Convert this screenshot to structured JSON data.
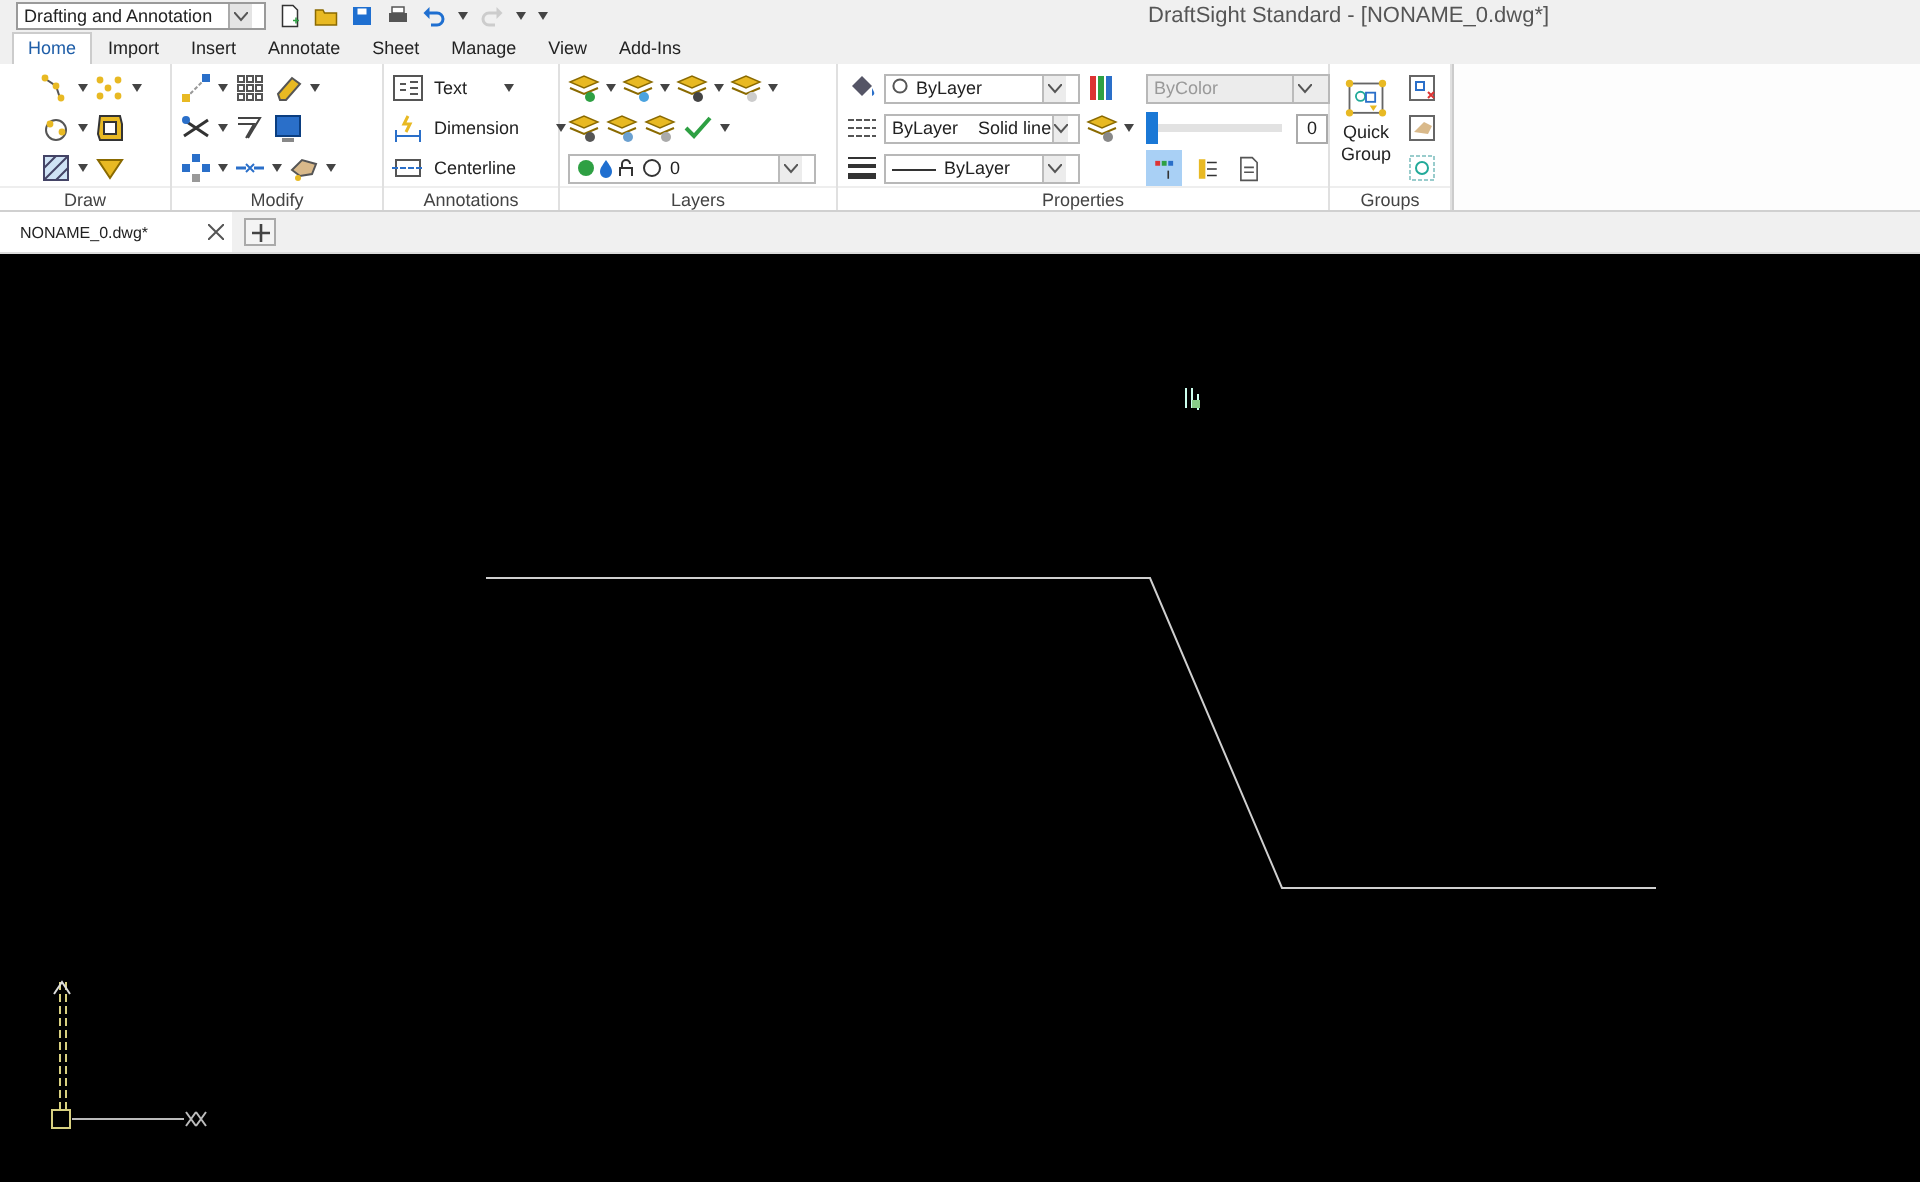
{
  "quick_access": {
    "workspace": "Drafting and Annotation"
  },
  "window": {
    "title": "DraftSight Standard - [NONAME_0.dwg*]"
  },
  "ribbon_tabs": [
    {
      "label": "Home",
      "selected": true
    },
    {
      "label": "Import",
      "selected": false
    },
    {
      "label": "Insert",
      "selected": false
    },
    {
      "label": "Annotate",
      "selected": false
    },
    {
      "label": "Sheet",
      "selected": false
    },
    {
      "label": "Manage",
      "selected": false
    },
    {
      "label": "View",
      "selected": false
    },
    {
      "label": "Add-Ins",
      "selected": false
    }
  ],
  "panels": [
    {
      "kind": "draw",
      "title": "Draw"
    },
    {
      "kind": "modify",
      "title": "Modify"
    },
    {
      "kind": "annotations",
      "title": "Annotations",
      "tools": [
        "Text",
        "Dimension",
        "Centerline"
      ]
    },
    {
      "kind": "layers",
      "title": "Layers",
      "layer": "0"
    },
    {
      "kind": "properties",
      "title": "Properties",
      "color_setting": "ByLayer",
      "linetype": "ByLayer",
      "linetype_name": "Solid line",
      "lineweight": "ByLayer",
      "plot_style": "ByColor",
      "plot_style_disabled": true,
      "transparency": {
        "level": 0,
        "value": "0"
      },
      "buttons": [
        {
          "on": true
        },
        {
          "on": false
        },
        {
          "on": false
        }
      ]
    },
    {
      "kind": "groups",
      "title": "Groups",
      "tool": "Quick Group"
    }
  ],
  "document_tabs": [
    {
      "label": "NONAME_0.dwg*",
      "selected": true
    }
  ]
}
